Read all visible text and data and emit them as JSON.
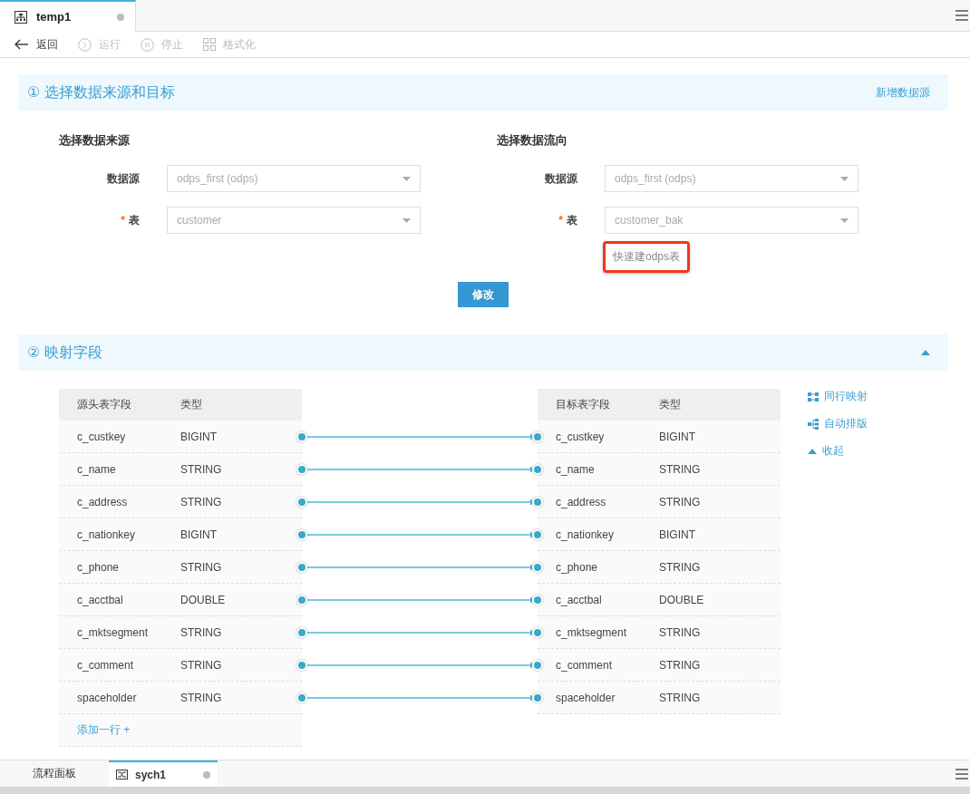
{
  "top_tabs": [
    {
      "label": "temp1",
      "selected": true
    }
  ],
  "toolbar": [
    {
      "kind": "back",
      "label": "返回",
      "disabled": false
    },
    {
      "kind": "run",
      "label": "运行",
      "disabled": true
    },
    {
      "kind": "stop",
      "label": "停止",
      "disabled": true
    },
    {
      "kind": "format",
      "label": "格式化",
      "disabled": true
    }
  ],
  "section1": {
    "title": "① 选择数据来源和目标",
    "action": "新增数据源",
    "source": {
      "title": "选择数据来源",
      "fields": [
        {
          "label": "数据源",
          "value": "odps_first (odps)"
        },
        {
          "required_mark": "*",
          "label": "表",
          "value": "customer"
        }
      ]
    },
    "target": {
      "title": "选择数据流向",
      "fields": [
        {
          "label": "数据源",
          "value": "odps_first (odps)"
        },
        {
          "required_mark": "*",
          "label": "表",
          "value": "customer_bak"
        }
      ],
      "link": "快速建odps表"
    },
    "button": "修改"
  },
  "section2": {
    "title": "② 映射字段",
    "expanded": true,
    "source_columns": [
      "源头表字段",
      "类型"
    ],
    "source_rows": [
      {
        "name": "c_custkey",
        "type": "BIGINT"
      },
      {
        "name": "c_name",
        "type": "STRING"
      },
      {
        "name": "c_address",
        "type": "STRING"
      },
      {
        "name": "c_nationkey",
        "type": "BIGINT"
      },
      {
        "name": "c_phone",
        "type": "STRING"
      },
      {
        "name": "c_acctbal",
        "type": "DOUBLE"
      },
      {
        "name": "c_mktsegment",
        "type": "STRING"
      },
      {
        "name": "c_comment",
        "type": "STRING"
      },
      {
        "name": "spaceholder",
        "type": "STRING"
      }
    ],
    "add_row": "添加一行 +",
    "target_columns": [
      "目标表字段",
      "类型"
    ],
    "target_rows": [
      {
        "name": "c_custkey",
        "type": "BIGINT"
      },
      {
        "name": "c_name",
        "type": "STRING"
      },
      {
        "name": "c_address",
        "type": "STRING"
      },
      {
        "name": "c_nationkey",
        "type": "BIGINT"
      },
      {
        "name": "c_phone",
        "type": "STRING"
      },
      {
        "name": "c_acctbal",
        "type": "DOUBLE"
      },
      {
        "name": "c_mktsegment",
        "type": "STRING"
      },
      {
        "name": "c_comment",
        "type": "STRING"
      },
      {
        "name": "spaceholder",
        "type": "STRING"
      }
    ],
    "actions": [
      {
        "kind": "same-row",
        "label": "同行映射"
      },
      {
        "kind": "auto-layout",
        "label": "自动排版"
      },
      {
        "kind": "collapse",
        "label": "收起"
      }
    ]
  },
  "bottom_tabs": [
    {
      "label": "流程面板",
      "selected": false,
      "kind": "plain"
    },
    {
      "label": "sych1",
      "selected": true,
      "kind": "flow"
    }
  ]
}
